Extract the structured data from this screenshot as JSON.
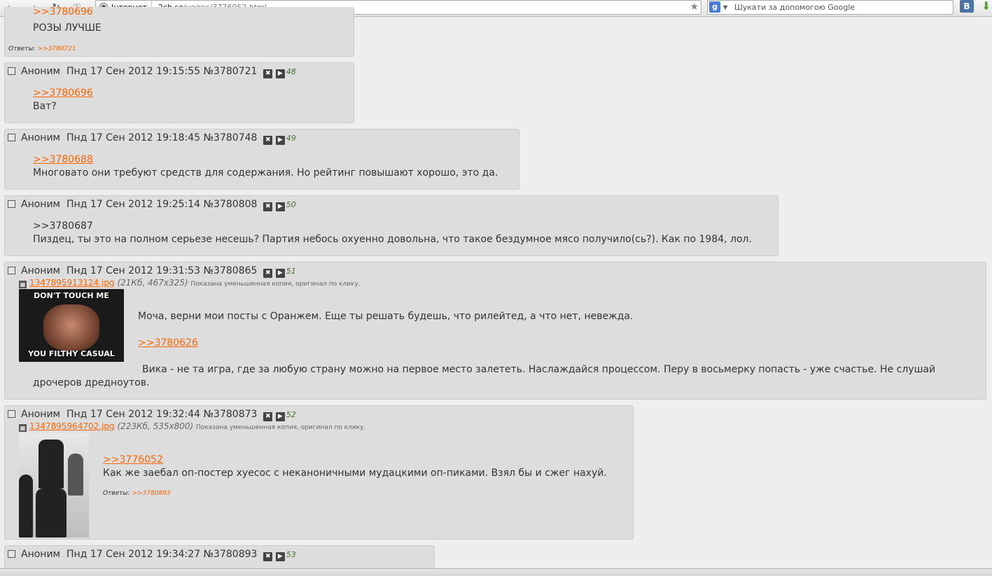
{
  "browser": {
    "site_tag": "Інтернет",
    "url_host": "2ch.so",
    "url_path": "/vg/res/3776052.html",
    "search_placeholder": "Шукати за допомогою Google",
    "vk_label": "В"
  },
  "posts": [
    {
      "message_lines": [
        "РОЗЫ ЛУЧШЕ"
      ],
      "top_ref": ">>3780696",
      "replies_label": "Ответы:",
      "replies": ">>3780721"
    },
    {
      "author": "Аноним",
      "date": "Пнд 17 Сен 2012 19:15:55",
      "id": "№3780721",
      "num": "48",
      "ref": ">>3780696",
      "text": "Ват?"
    },
    {
      "author": "Аноним",
      "date": "Пнд 17 Сен 2012 19:18:45",
      "id": "№3780748",
      "num": "49",
      "ref": ">>3780688",
      "text": "Многовато они требуют средств для содержания. Но рейтинг повышают хорошо, это да."
    },
    {
      "author": "Аноним",
      "date": "Пнд 17 Сен 2012 19:25:14",
      "id": "№3780808",
      "num": "50",
      "ref": ">>3780687",
      "text": "Пиздец, ты это на полном серьезе несешь? Партия небось охуенно довольна, что такое бездумное мясо получило(сь?). Как по 1984, лол."
    },
    {
      "author": "Аноним",
      "date": "Пнд 17 Сен 2012 19:31:53",
      "id": "№3780865",
      "num": "51",
      "file_name": "1347895913124.jpg",
      "file_meta": "(21Кб, 467x325)",
      "file_note": "Показана уменьшенная копия, оригинал по клику.",
      "thumb_top_text": "DON'T TOUCH ME",
      "thumb_bottom_text": "YOU FILTHY CASUAL",
      "text1": "Моча, верни мои посты с Оранжем. Еще ты решать будешь, что рилейтед, а что нет, невежда.",
      "ref": ">>3780626",
      "text2_line1": "Вика - не та игра, где за любую страну можно на первое место залететь. Наслаждайся процессом. Перу в восьмерку попасть - уже счастье. Не слушай",
      "text2_line2": "дрочеров дредноутов."
    },
    {
      "author": "Аноним",
      "date": "Пнд 17 Сен 2012 19:32:44",
      "id": "№3780873",
      "num": "52",
      "file_name": "1347895964702.jpg",
      "file_meta": "(223Кб, 535x800)",
      "file_note": "Показана уменьшенная копия, оригинал по клику.",
      "ref": ">>3776052",
      "text": "Как же заебал оп-постер хуесос с неканоничными мудацкими оп-пиками. Взял бы и сжег нахуй.",
      "replies_label": "Ответы:",
      "replies": ">>3780893"
    },
    {
      "author": "Аноним",
      "date": "Пнд 17 Сен 2012 19:34:27",
      "id": "№3780893",
      "num": "53"
    }
  ]
}
